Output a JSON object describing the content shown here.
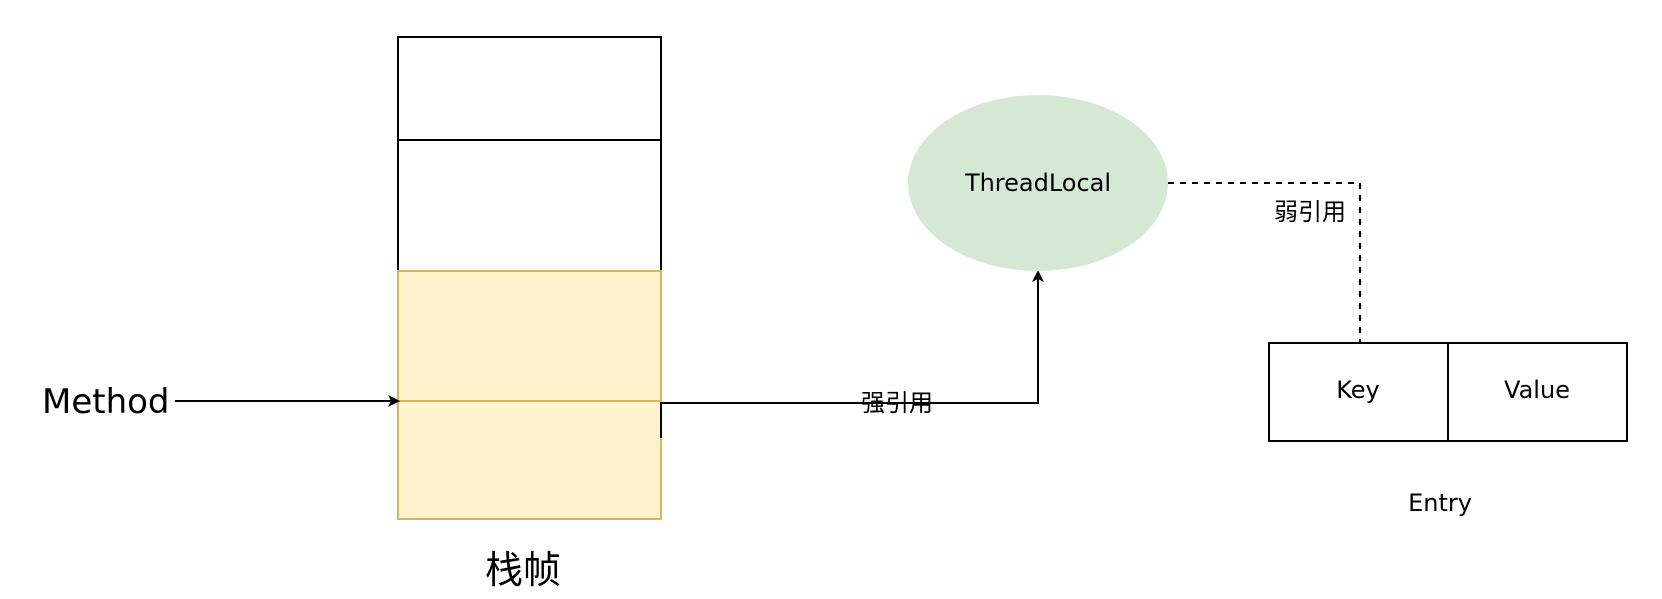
{
  "diagram": {
    "method_label": "Method",
    "stack_label": "栈帧",
    "threadlocal_label": "ThreadLocal",
    "strong_ref_label": "强引用",
    "weak_ref_label": "弱引用",
    "key_label": "Key",
    "value_label": "Value",
    "entry_label": "Entry"
  },
  "colors": {
    "stack_fill": "#fff2cc",
    "stack_stroke": "#d6b656",
    "threadlocal_fill": "#d5e8d4",
    "line": "#000000"
  }
}
